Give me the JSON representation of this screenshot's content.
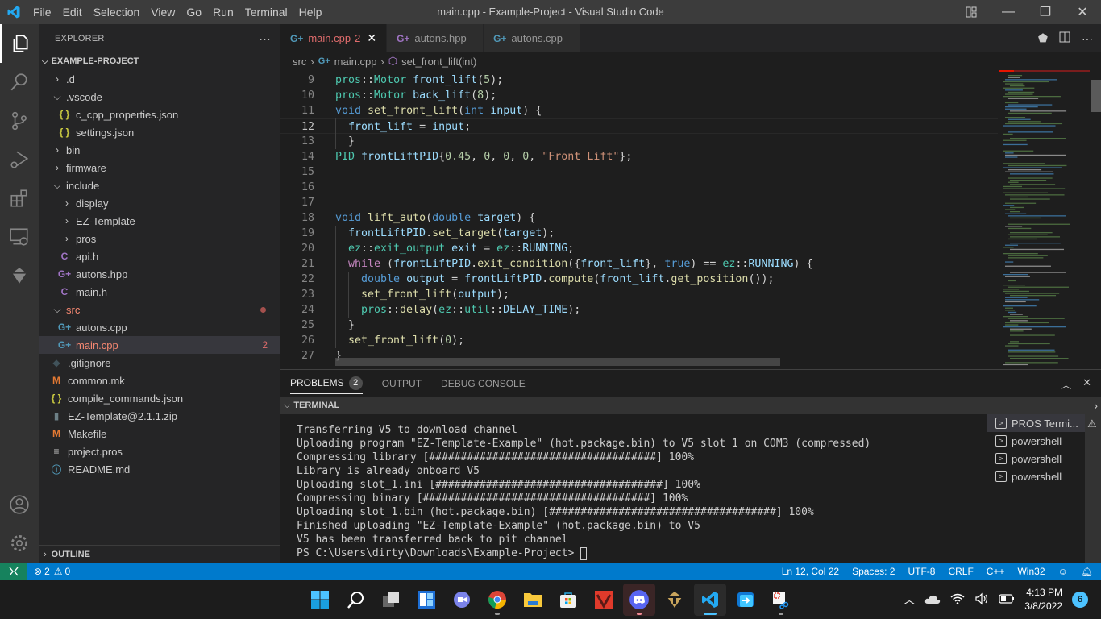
{
  "titlebar": {
    "menu": [
      "File",
      "Edit",
      "Selection",
      "View",
      "Go",
      "Run",
      "Terminal",
      "Help"
    ],
    "window_title": "main.cpp - Example-Project - Visual Studio Code"
  },
  "activity_bar": [
    "explorer-icon",
    "search-icon",
    "source-control-icon",
    "run-debug-icon",
    "extensions-icon",
    "remote-explorer-icon",
    "pros-icon",
    "account-icon",
    "settings-gear-icon"
  ],
  "sidebar": {
    "title": "EXPLORER",
    "more": "···",
    "project": "EXAMPLE-PROJECT",
    "tree": [
      {
        "label": ".d",
        "type": "folder",
        "open": false,
        "depth": 1
      },
      {
        "label": ".vscode",
        "type": "folder",
        "open": true,
        "depth": 1
      },
      {
        "label": "c_cpp_properties.json",
        "type": "json",
        "depth": 2
      },
      {
        "label": "settings.json",
        "type": "json",
        "depth": 2
      },
      {
        "label": "bin",
        "type": "folder",
        "open": false,
        "depth": 1
      },
      {
        "label": "firmware",
        "type": "folder",
        "open": false,
        "depth": 1
      },
      {
        "label": "include",
        "type": "folder",
        "open": true,
        "depth": 1
      },
      {
        "label": "display",
        "type": "folder",
        "open": false,
        "depth": 2
      },
      {
        "label": "EZ-Template",
        "type": "folder",
        "open": false,
        "depth": 2
      },
      {
        "label": "pros",
        "type": "folder",
        "open": false,
        "depth": 2
      },
      {
        "label": "api.h",
        "type": "c",
        "depth": 2
      },
      {
        "label": "autons.hpp",
        "type": "hpp",
        "depth": 2
      },
      {
        "label": "main.h",
        "type": "c",
        "depth": 2
      },
      {
        "label": "src",
        "type": "folder",
        "open": true,
        "depth": 1,
        "error": true,
        "dot": true
      },
      {
        "label": "autons.cpp",
        "type": "cpp",
        "depth": 2
      },
      {
        "label": "main.cpp",
        "type": "cpp",
        "depth": 2,
        "error": true,
        "selected": true,
        "badge": "2"
      },
      {
        "label": ".gitignore",
        "type": "git",
        "depth": 1
      },
      {
        "label": "common.mk",
        "type": "make",
        "depth": 1
      },
      {
        "label": "compile_commands.json",
        "type": "json",
        "depth": 1
      },
      {
        "label": "EZ-Template@2.1.1.zip",
        "type": "zip",
        "depth": 1
      },
      {
        "label": "Makefile",
        "type": "make",
        "depth": 1
      },
      {
        "label": "project.pros",
        "type": "text",
        "depth": 1
      },
      {
        "label": "README.md",
        "type": "info",
        "depth": 1
      }
    ],
    "outline": "OUTLINE"
  },
  "tabs": [
    {
      "label": "main.cpp",
      "badge": "2",
      "active": true,
      "icon": "cpp"
    },
    {
      "label": "autons.hpp",
      "active": false,
      "icon": "hpp"
    },
    {
      "label": "autons.cpp",
      "active": false,
      "icon": "cpp"
    }
  ],
  "breadcrumb": [
    "src",
    "main.cpp",
    "set_front_lift(int)"
  ],
  "editor": {
    "current_line": 12,
    "lines": [
      {
        "n": 9,
        "indent": 0,
        "tokens": [
          [
            "ty",
            "pros"
          ],
          [
            "pl",
            "::"
          ],
          [
            "ty",
            "Motor"
          ],
          [
            "pl",
            " "
          ],
          [
            "var",
            "front_lift"
          ],
          [
            "pl",
            "("
          ],
          [
            "num",
            "5"
          ],
          [
            "pl",
            ");"
          ]
        ]
      },
      {
        "n": 10,
        "indent": 0,
        "tokens": [
          [
            "ty",
            "pros"
          ],
          [
            "pl",
            "::"
          ],
          [
            "ty",
            "Motor"
          ],
          [
            "pl",
            " "
          ],
          [
            "var",
            "back_lift"
          ],
          [
            "pl",
            "("
          ],
          [
            "num",
            "8"
          ],
          [
            "pl",
            ");"
          ]
        ]
      },
      {
        "n": 11,
        "indent": 0,
        "tokens": [
          [
            "kw",
            "void"
          ],
          [
            "pl",
            " "
          ],
          [
            "fn",
            "set_front_lift"
          ],
          [
            "pl",
            "("
          ],
          [
            "kw",
            "int"
          ],
          [
            "pl",
            " "
          ],
          [
            "var",
            "input"
          ],
          [
            "pl",
            ") {"
          ]
        ]
      },
      {
        "n": 12,
        "indent": 1,
        "tokens": [
          [
            "var",
            "front_lift"
          ],
          [
            "pl",
            " = "
          ],
          [
            "var",
            "input"
          ],
          [
            "pl",
            ";"
          ]
        ]
      },
      {
        "n": 13,
        "indent": 1,
        "tokens": [
          [
            "pl",
            "}"
          ]
        ]
      },
      {
        "n": 14,
        "indent": 0,
        "tokens": [
          [
            "ty",
            "PID"
          ],
          [
            "pl",
            " "
          ],
          [
            "var",
            "frontLiftPID"
          ],
          [
            "pl",
            "{"
          ],
          [
            "num",
            "0.45"
          ],
          [
            "pl",
            ", "
          ],
          [
            "num",
            "0"
          ],
          [
            "pl",
            ", "
          ],
          [
            "num",
            "0"
          ],
          [
            "pl",
            ", "
          ],
          [
            "num",
            "0"
          ],
          [
            "pl",
            ", "
          ],
          [
            "str",
            "\"Front Lift\""
          ],
          [
            "pl",
            "};"
          ]
        ]
      },
      {
        "n": 15,
        "indent": 0,
        "tokens": []
      },
      {
        "n": 16,
        "indent": 0,
        "tokens": []
      },
      {
        "n": 17,
        "indent": 0,
        "tokens": []
      },
      {
        "n": 18,
        "indent": 0,
        "tokens": [
          [
            "kw",
            "void"
          ],
          [
            "pl",
            " "
          ],
          [
            "fn",
            "lift_auto"
          ],
          [
            "pl",
            "("
          ],
          [
            "kw",
            "double"
          ],
          [
            "pl",
            " "
          ],
          [
            "var",
            "target"
          ],
          [
            "pl",
            ") {"
          ]
        ]
      },
      {
        "n": 19,
        "indent": 1,
        "tokens": [
          [
            "var",
            "frontLiftPID"
          ],
          [
            "pl",
            "."
          ],
          [
            "fn",
            "set_target"
          ],
          [
            "pl",
            "("
          ],
          [
            "var",
            "target"
          ],
          [
            "pl",
            ");"
          ]
        ]
      },
      {
        "n": 20,
        "indent": 1,
        "tokens": [
          [
            "ty",
            "ez"
          ],
          [
            "pl",
            "::"
          ],
          [
            "ty",
            "exit_output"
          ],
          [
            "pl",
            " "
          ],
          [
            "var",
            "exit"
          ],
          [
            "pl",
            " = "
          ],
          [
            "ty",
            "ez"
          ],
          [
            "pl",
            "::"
          ],
          [
            "var",
            "RUNNING"
          ],
          [
            "pl",
            ";"
          ]
        ]
      },
      {
        "n": 21,
        "indent": 1,
        "tokens": [
          [
            "ctl",
            "while"
          ],
          [
            "pl",
            " ("
          ],
          [
            "var",
            "frontLiftPID"
          ],
          [
            "pl",
            "."
          ],
          [
            "fn",
            "exit_condition"
          ],
          [
            "pl",
            "({"
          ],
          [
            "var",
            "front_lift"
          ],
          [
            "pl",
            "}, "
          ],
          [
            "kw",
            "true"
          ],
          [
            "pl",
            ") == "
          ],
          [
            "ty",
            "ez"
          ],
          [
            "pl",
            "::"
          ],
          [
            "var",
            "RUNNING"
          ],
          [
            "pl",
            ") {"
          ]
        ]
      },
      {
        "n": 22,
        "indent": 2,
        "tokens": [
          [
            "kw",
            "double"
          ],
          [
            "pl",
            " "
          ],
          [
            "var",
            "output"
          ],
          [
            "pl",
            " = "
          ],
          [
            "var",
            "frontLiftPID"
          ],
          [
            "pl",
            "."
          ],
          [
            "fn",
            "compute"
          ],
          [
            "pl",
            "("
          ],
          [
            "var",
            "front_lift"
          ],
          [
            "pl",
            "."
          ],
          [
            "fn",
            "get_position"
          ],
          [
            "pl",
            "());"
          ]
        ]
      },
      {
        "n": 23,
        "indent": 2,
        "tokens": [
          [
            "fn",
            "set_front_lift"
          ],
          [
            "pl",
            "("
          ],
          [
            "var",
            "output"
          ],
          [
            "pl",
            ");"
          ]
        ]
      },
      {
        "n": 24,
        "indent": 2,
        "tokens": [
          [
            "ty",
            "pros"
          ],
          [
            "pl",
            "::"
          ],
          [
            "fn",
            "delay"
          ],
          [
            "pl",
            "("
          ],
          [
            "ty",
            "ez"
          ],
          [
            "pl",
            "::"
          ],
          [
            "ty",
            "util"
          ],
          [
            "pl",
            "::"
          ],
          [
            "var",
            "DELAY_TIME"
          ],
          [
            "pl",
            ");"
          ]
        ]
      },
      {
        "n": 25,
        "indent": 1,
        "tokens": [
          [
            "pl",
            "}"
          ]
        ]
      },
      {
        "n": 26,
        "indent": 1,
        "tokens": [
          [
            "fn",
            "set_front_lift"
          ],
          [
            "pl",
            "("
          ],
          [
            "num",
            "0"
          ],
          [
            "pl",
            ");"
          ]
        ]
      },
      {
        "n": 27,
        "indent": 0,
        "tokens": [
          [
            "pl",
            "}"
          ]
        ]
      }
    ]
  },
  "panel": {
    "tabs": [
      {
        "label": "PROBLEMS",
        "badge": "2",
        "active": true
      },
      {
        "label": "OUTPUT",
        "active": false
      },
      {
        "label": "DEBUG CONSOLE",
        "active": false
      }
    ],
    "terminal_header": "TERMINAL",
    "terminal_lines": [
      "Transferring V5 to download channel",
      "Uploading program \"EZ-Template-Example\" (hot.package.bin) to V5 slot 1 on COM3 (compressed)",
      "Compressing library [####################################] 100%",
      "Library is already onboard V5",
      "Uploading slot_1.ini [####################################] 100%",
      "Compressing binary [####################################] 100%",
      "Uploading slot_1.bin (hot.package.bin) [####################################] 100%",
      "Finished uploading \"EZ-Template-Example\" (hot.package.bin) to V5",
      "V5 has been transferred back to pit channel",
      "PS C:\\Users\\dirty\\Downloads\\Example-Project> "
    ],
    "terminals": [
      {
        "label": "PROS Termi...",
        "active": true
      },
      {
        "label": "powershell",
        "active": false
      },
      {
        "label": "powershell",
        "active": false
      },
      {
        "label": "powershell",
        "active": false
      }
    ]
  },
  "statusbar": {
    "errors": "2",
    "warnings": "0",
    "position": "Ln 12, Col 22",
    "spaces": "Spaces: 2",
    "encoding": "UTF-8",
    "eol": "CRLF",
    "language": "C++",
    "platform": "Win32"
  },
  "taskbar": {
    "apps": [
      "start-icon",
      "search-icon",
      "task-view-icon",
      "widgets-icon",
      "teams-chat-icon",
      "chrome-icon",
      "file-explorer-icon",
      "microsoft-store-icon",
      "pro-app-icon",
      "discord-icon",
      "helmet-app-icon",
      "vscode-icon",
      "remote-desktop-icon",
      "snipping-tool-icon"
    ],
    "time": "4:13 PM",
    "date": "3/8/2022",
    "notifications": "6"
  },
  "colors": {
    "accent": "#007acc",
    "error": "#f48771",
    "remote": "#16825d"
  }
}
